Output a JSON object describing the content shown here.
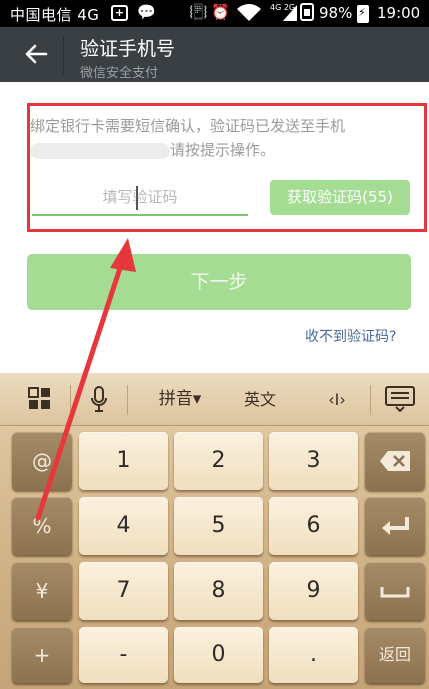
{
  "status_bar": {
    "carrier": "中国电信 4G",
    "network": "4G 2G",
    "battery": "98%",
    "time": "19:00"
  },
  "header": {
    "back_icon": "arrow-left-icon",
    "title": "验证手机号",
    "subtitle": "微信安全支付"
  },
  "notice": {
    "part1": "绑定银行卡需要短信确认，验证码已发送至手机",
    "part2": "请按提示操作。"
  },
  "code_field": {
    "placeholder": "填写验证码",
    "value": ""
  },
  "get_code_button": "获取验证码(55)",
  "next_button": "下一步",
  "no_code_link": "收不到验证码?",
  "keyboard": {
    "toolbar": {
      "menu_icon": "grid-icon",
      "voice_icon": "microphone-icon",
      "pinyin": "拼音▾",
      "english": "英文",
      "cursor": "‹I›",
      "hide_icon": "keyboard-hide-icon"
    },
    "left_keys": [
      "@",
      "%",
      "¥",
      "+"
    ],
    "digits": [
      "1",
      "2",
      "3",
      "4",
      "5",
      "6",
      "7",
      "8",
      "9",
      "-",
      "0",
      "."
    ],
    "right_keys": {
      "backspace": "⌫",
      "enter": "↵",
      "space": "␣",
      "back": "返回"
    }
  },
  "colors": {
    "header_bg": "#3a3f43",
    "accent_green": "#a4dc94",
    "highlight_red": "#e6383c",
    "link_blue": "#4b6a94"
  }
}
